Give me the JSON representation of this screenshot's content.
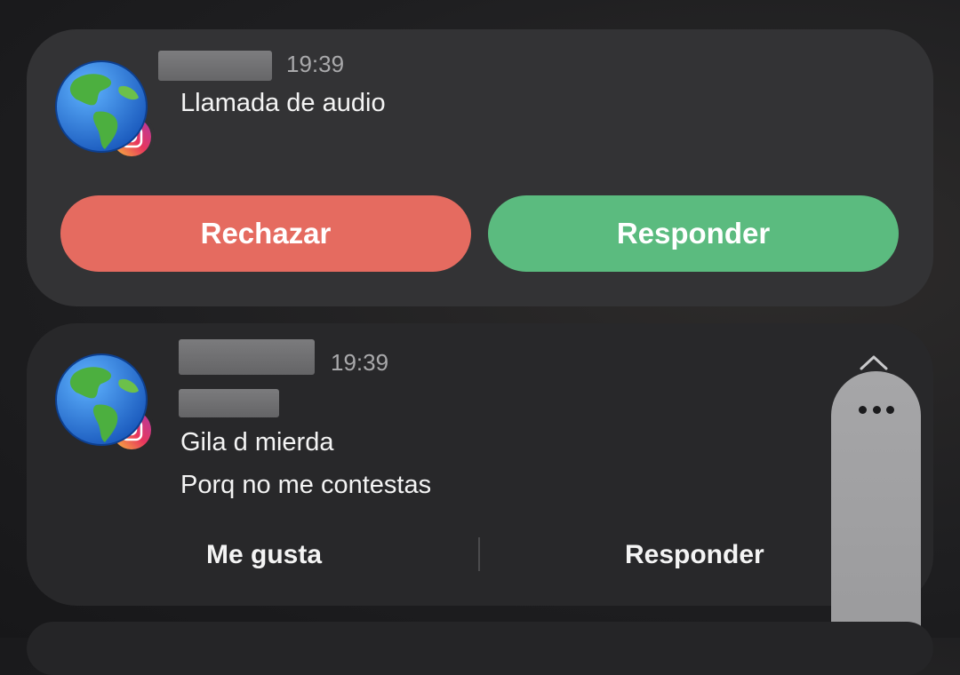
{
  "call_notification": {
    "time": "19:39",
    "message": "Llamada de audio",
    "reject_label": "Rechazar",
    "answer_label": "Responder"
  },
  "message_notification": {
    "time": "19:39",
    "lines": [
      "Gila d mierda",
      "Porq no me contestas"
    ],
    "like_label": "Me gusta",
    "reply_label": "Responder"
  },
  "icons": {
    "avatar": "globe-americas-icon",
    "app_badge": "instagram-icon",
    "collapse": "chevron-up-icon",
    "more": "more-horizontal-icon"
  },
  "colors": {
    "reject": "#e56b60",
    "answer": "#5bbb7f",
    "card": "#333335"
  }
}
